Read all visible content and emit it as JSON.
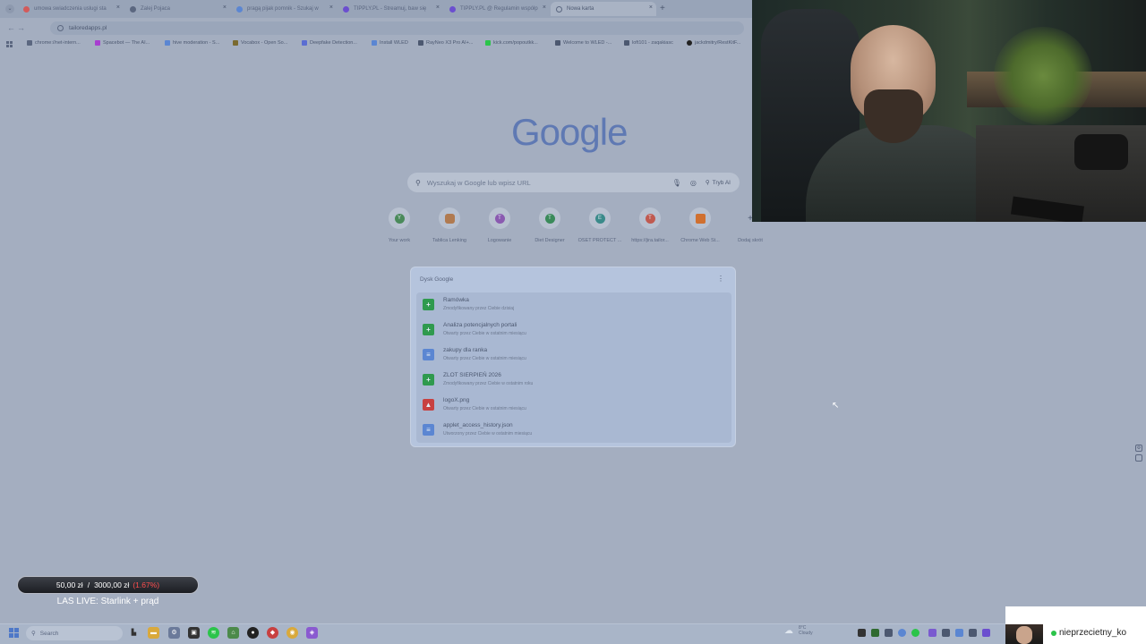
{
  "tabs": [
    {
      "label": "umowa swiadczenia uslugi sta",
      "color": "#d25b5b"
    },
    {
      "label": "Zalej Pojaca",
      "color": "#5b6780"
    },
    {
      "label": "pragą pijak pomnik - Szukaj w",
      "color": "#5b86d2"
    },
    {
      "label": "TIPPLY.PL - Streamuj, baw się",
      "color": "#6b4fcf"
    },
    {
      "label": "TIPPLY.PL @ Regulamin współp",
      "color": "#6b4fcf"
    },
    {
      "label": "Nowa karta",
      "color": "#5b6780"
    }
  ],
  "address": {
    "value": "tailoredapps.pl"
  },
  "bookmarks": [
    {
      "label": "chrome://net-intern...",
      "color": "#5b6780"
    },
    {
      "label": "Spacebot — The AI...",
      "color": "#a83fd0"
    },
    {
      "label": "hive moderation - S...",
      "color": "#5b86d2"
    },
    {
      "label": "Vocabox - Open So...",
      "color": "#7a6a30"
    },
    {
      "label": "Deepfake Detection...",
      "color": "#5b6ed2"
    },
    {
      "label": "Install WLED",
      "color": "#5b86d2"
    },
    {
      "label": "RayNeo X3 Pro AI+...",
      "color": "#4c5870"
    },
    {
      "label": "kick.com/popoutkk...",
      "color": "#2bc44a"
    },
    {
      "label": "Welcome to WLED -...",
      "color": "#4c5870"
    },
    {
      "label": "loft101 - zaqakiasc",
      "color": "#4c5870"
    },
    {
      "label": "jackdmitry/RestKitF...",
      "color": "#222222"
    }
  ],
  "search": {
    "placeholder": "Wyszukaj w Google lub wpisz URL",
    "ai_label": "Tryb AI"
  },
  "shortcuts": [
    {
      "label": "Your work",
      "letter": "Y",
      "color": "#4a8a5a"
    },
    {
      "label": "Tablica Lenking",
      "letter": "",
      "color": "#b07a50"
    },
    {
      "label": "Logowanie",
      "letter": "T",
      "color": "#8a5ab0"
    },
    {
      "label": "Diet Designer",
      "letter": "T",
      "color": "#3a8a5a"
    },
    {
      "label": "OSET PROTECT ...",
      "letter": "E",
      "color": "#3a8a8a"
    },
    {
      "label": "https://jira.tailor...",
      "letter": "T",
      "color": "#c05a50"
    },
    {
      "label": "Chrome Web St...",
      "letter": "",
      "color": "#d07030"
    },
    {
      "label": "Dodaj skrót",
      "letter": "+",
      "color": "#5b6780"
    }
  ],
  "drive": {
    "heading": "Dysk Google",
    "items": [
      {
        "title": "Ramówka",
        "sub": "Zmodyfikowany przez Ciebie dzisiaj",
        "icon": "+",
        "color": "#2f9a4e"
      },
      {
        "title": "Analiza potencjalnych portali",
        "sub": "Otwarty przez Ciebie w ostatnim miesiącu",
        "icon": "+",
        "color": "#2f9a4e"
      },
      {
        "title": "zakupy dla ranka",
        "sub": "Otwarty przez Ciebie w ostatnim miesiącu",
        "icon": "≡",
        "color": "#5b86d2"
      },
      {
        "title": "ZLOT SIERPIEŃ 2026",
        "sub": "Zmodyfikowany przez Ciebie w ostatnim roku",
        "icon": "+",
        "color": "#2f9a4e"
      },
      {
        "title": "logoX.png",
        "sub": "Otwarty przez Ciebie w ostatnim miesiącu",
        "icon": "▲",
        "color": "#c84040"
      },
      {
        "title": "applet_access_history.json",
        "sub": "Utworzony przez Ciebie w ostatnim miesiącu",
        "icon": "≡",
        "color": "#5b86d2"
      }
    ]
  },
  "overlay": {
    "goal_current": "50,00 zł",
    "goal_separator": "/",
    "goal_target": "3000,00 zł",
    "goal_percent": "(1.67%)",
    "live_title": "LAS LIVE: Starlink + prąd"
  },
  "taskbar": {
    "search_placeholder": "Search",
    "weather_temp": "8°C",
    "weather_desc": "Cloudy"
  },
  "viewer": {
    "name": "nieprzecietny_ko"
  }
}
